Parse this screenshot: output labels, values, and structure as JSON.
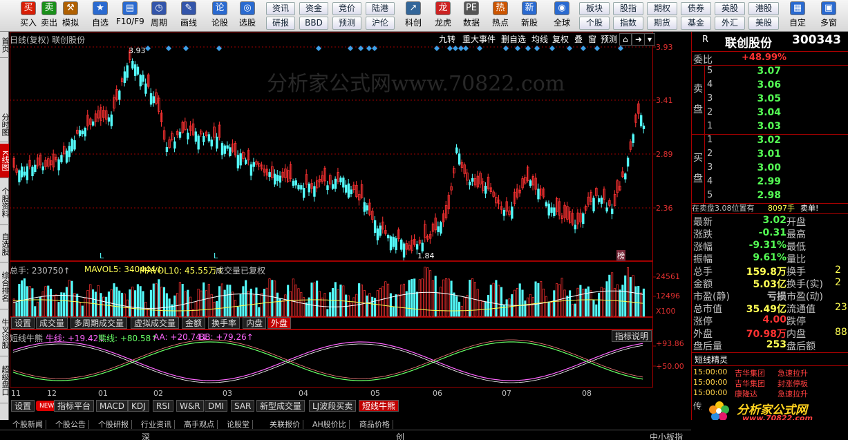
{
  "toolbar": {
    "buttons": [
      {
        "label": "买入",
        "icon": "buy-icon",
        "color": "#d81e06"
      },
      {
        "label": "卖出",
        "icon": "sell-icon",
        "color": "#1a8f1a"
      },
      {
        "label": "模拟",
        "icon": "hammer-icon",
        "color": "#b06000"
      },
      {
        "label": "自选",
        "icon": "star-icon",
        "color": "#2a6ad0"
      },
      {
        "label": "F10/F9",
        "icon": "f10-icon",
        "color": "#2a6ad0"
      },
      {
        "label": "周期",
        "icon": "clock-icon",
        "color": "#3355aa"
      },
      {
        "label": "画线",
        "icon": "pencil-icon",
        "color": "#3355aa"
      },
      {
        "label": "论股",
        "icon": "discuss-icon",
        "color": "#2a6ad0"
      },
      {
        "label": "选股",
        "icon": "select-stock-icon",
        "color": "#2a6ad0"
      },
      {
        "label": "科创",
        "icon": "kechuang-icon",
        "color": "#336699"
      },
      {
        "label": "龙虎",
        "icon": "longhu-icon",
        "color": "#cc2222"
      },
      {
        "label": "数据",
        "icon": "data-icon",
        "color": "#555555"
      },
      {
        "label": "热点",
        "icon": "hot-icon",
        "color": "#cc5500"
      },
      {
        "label": "新股",
        "icon": "new-stock-icon",
        "color": "#2a6ad0"
      },
      {
        "label": "全球",
        "icon": "globe-icon",
        "color": "#2a6ad0"
      },
      {
        "label": "自定",
        "icon": "custom-icon",
        "color": "#2a6ad0"
      },
      {
        "label": "多窗",
        "icon": "multiwindow-icon",
        "color": "#2a6ad0"
      }
    ],
    "grid1": [
      "资讯",
      "研报",
      "资金",
      "BBD",
      "竞价",
      "预测",
      "陆港",
      "沪伦"
    ],
    "grid2": [
      "板块",
      "个股",
      "股指",
      "指数",
      "期权",
      "期货",
      "债券",
      "基金",
      "英股",
      "外汇",
      "港股",
      "美股"
    ]
  },
  "left_tabs": [
    "首页",
    "分时图",
    "K线图",
    "个股资料",
    "自选股",
    "综合排名",
    "牛叉诊股",
    "超级盘口"
  ],
  "chart": {
    "title": "日线(复权)  联创股份",
    "top_tabs": [
      "九转",
      "重大事件",
      "删自选",
      "均线",
      "复权",
      "叠",
      "窗",
      "预测"
    ],
    "price_axis": [
      "3.93",
      "3.41",
      "2.89",
      "2.36"
    ],
    "high_label": "3.93",
    "low_label": "1.84",
    "markers": [
      "L",
      "L",
      "榜"
    ],
    "watermark": "分析家公式网www.70822.com",
    "volume_header": {
      "total": "总手: 230750↑",
      "ma5": "MAVOL5: 340444↓",
      "ma10": "MAVOL10: 45.55万↑",
      "note": "成交量已复权"
    },
    "volume_axis": [
      "24561",
      "12496",
      "X100"
    ],
    "volume_tabs": [
      "设置",
      "成交量",
      "多周期成交量",
      "虚拟成交量",
      "金额",
      "换手率",
      "内盘",
      "外盘"
    ],
    "indicator_header": {
      "name": "短线牛熊",
      "niu": "牛线: +19.42↓",
      "xiong": "熊线: +80.58↑",
      "aa": "AA: +20.74↓",
      "bb": "BB: +79.26↑"
    },
    "indicator_button": "指标说明",
    "indicator_axis": [
      "+93.86",
      "+50.00"
    ],
    "x_labels": [
      "11",
      "12",
      "01",
      "02",
      "03",
      "04",
      "05",
      "06",
      "07",
      "08"
    ],
    "bottom_tabs": [
      "设置",
      "NEW",
      "指标平台",
      "MACD",
      "KDJ",
      "RSI",
      "W&R",
      "DMI",
      "SAR",
      "新型成交量",
      "LJ波段买卖",
      "短线牛熊"
    ],
    "colors": {
      "up": "#ff3232",
      "down": "#54fcfc",
      "axis": "#a00000",
      "niu": "#ff66ff",
      "xiong": "#66ff66",
      "aa": "#ffffff",
      "bb": "#ff8080"
    }
  },
  "quote": {
    "code_label": "R",
    "name": "联创股份",
    "code": "300343",
    "weibi_label": "委比",
    "weibi_value": "+48.99%",
    "sell_label": "卖盘",
    "buy_label": "买盘",
    "sell": [
      {
        "lv": "5",
        "price": "3.07"
      },
      {
        "lv": "4",
        "price": "3.06"
      },
      {
        "lv": "3",
        "price": "3.05"
      },
      {
        "lv": "2",
        "price": "3.04"
      },
      {
        "lv": "1",
        "price": "3.03"
      }
    ],
    "buy": [
      {
        "lv": "1",
        "price": "3.02"
      },
      {
        "lv": "2",
        "price": "3.01"
      },
      {
        "lv": "3",
        "price": "3.00"
      },
      {
        "lv": "4",
        "price": "2.99"
      },
      {
        "lv": "5",
        "price": "2.98"
      }
    ],
    "zaimai": {
      "text": "在卖盘3.08位置有",
      "qty": "8097手",
      "action": "卖单!"
    },
    "stats": [
      {
        "k": "最新",
        "v": "3.02",
        "vc": "#54fc54",
        "k2": "开盘",
        "v2": ""
      },
      {
        "k": "涨跌",
        "v": "-0.31",
        "vc": "#54fc54",
        "k2": "最高",
        "v2": ""
      },
      {
        "k": "涨幅",
        "v": "-9.31%",
        "vc": "#54fc54",
        "k2": "最低",
        "v2": ""
      },
      {
        "k": "振幅",
        "v": "9.61%",
        "vc": "#54fc54",
        "k2": "量比",
        "v2": ""
      },
      {
        "k": "总手",
        "v": "159.8万",
        "vc": "#ffff54",
        "k2": "换手",
        "v2": "2"
      },
      {
        "k": "金额",
        "v": "5.03亿",
        "vc": "#ffff54",
        "k2": "换手(实)",
        "v2": "2"
      },
      {
        "k": "市盈(静)",
        "v": "亏损",
        "vc": "#c0c0c0",
        "k2": "市盈(动)",
        "v2": ""
      },
      {
        "k": "总市值",
        "v": "35.49亿",
        "vc": "#ffff54",
        "k2": "流通值",
        "v2": "23"
      },
      {
        "k": "涨停",
        "v": "4.00",
        "vc": "#ff3232",
        "k2": "跌停",
        "v2": ""
      },
      {
        "k": "外盘",
        "v": "70.98万",
        "vc": "#ff3232",
        "k2": "内盘",
        "v2": "88"
      },
      {
        "k": "盘后量",
        "v": "253",
        "vc": "#ffff54",
        "k2": "盘后额",
        "v2": ""
      }
    ],
    "jingling_title": "短线精灵",
    "jingling": [
      {
        "time": "15:00:00",
        "name": "吉华集团",
        "event": "急速拉升"
      },
      {
        "time": "15:00:00",
        "name": "吉华集团",
        "event": "封涨停板"
      },
      {
        "time": "15:00:00",
        "name": "康隆达",
        "event": "急速拉升"
      }
    ],
    "bottom": "传媒",
    "logo_text": "分析家公式网",
    "logo_url": "www.70822.com"
  },
  "status": {
    "tabs": [
      "个股新闻",
      "个股公告",
      "个股研报",
      "行业资讯",
      "高手观点",
      "论股堂",
      "关联报价",
      "AH股价比",
      "商品价格"
    ],
    "markets": [
      "深",
      "创",
      "中小板指"
    ]
  }
}
